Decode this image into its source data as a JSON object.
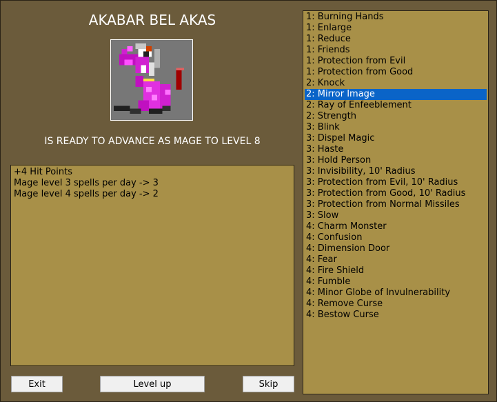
{
  "character": {
    "name": "AKABAR BEL AKAS",
    "advance_text": "IS READY TO ADVANCE AS MAGE TO LEVEL 8"
  },
  "info": {
    "lines": [
      "+4 Hit Points",
      "Mage level 3 spells per day -> 3",
      "Mage level 4 spells per day -> 2"
    ]
  },
  "spells": {
    "selected_index": 7,
    "items": [
      "1: Burning Hands",
      "1: Enlarge",
      "1: Reduce",
      "1: Friends",
      "1: Protection from Evil",
      "1: Protection from Good",
      "2: Knock",
      "2: Mirror Image",
      "2: Ray of Enfeeblement",
      "2: Strength",
      "3: Blink",
      "3: Dispel Magic",
      "3: Haste",
      "3: Hold Person",
      "3: Invisibility, 10' Radius",
      "3: Protection from Evil, 10' Radius",
      "3: Protection from Good, 10' Radius",
      "3: Protection from Normal Missiles",
      "3: Slow",
      "4: Charm Monster",
      "4: Confusion",
      "4: Dimension Door",
      "4: Fear",
      "4: Fire Shield",
      "4: Fumble",
      "4: Minor Globe of Invulnerability",
      "4: Remove Curse",
      "4: Bestow Curse"
    ]
  },
  "buttons": {
    "exit": "Exit",
    "level_up": "Level up",
    "skip": "Skip"
  },
  "colors": {
    "window_bg": "#6b5b3b",
    "panel_bg": "#a89048",
    "selection": "#0a64c8"
  },
  "icons": {
    "portrait": "mage-portrait-icon"
  }
}
